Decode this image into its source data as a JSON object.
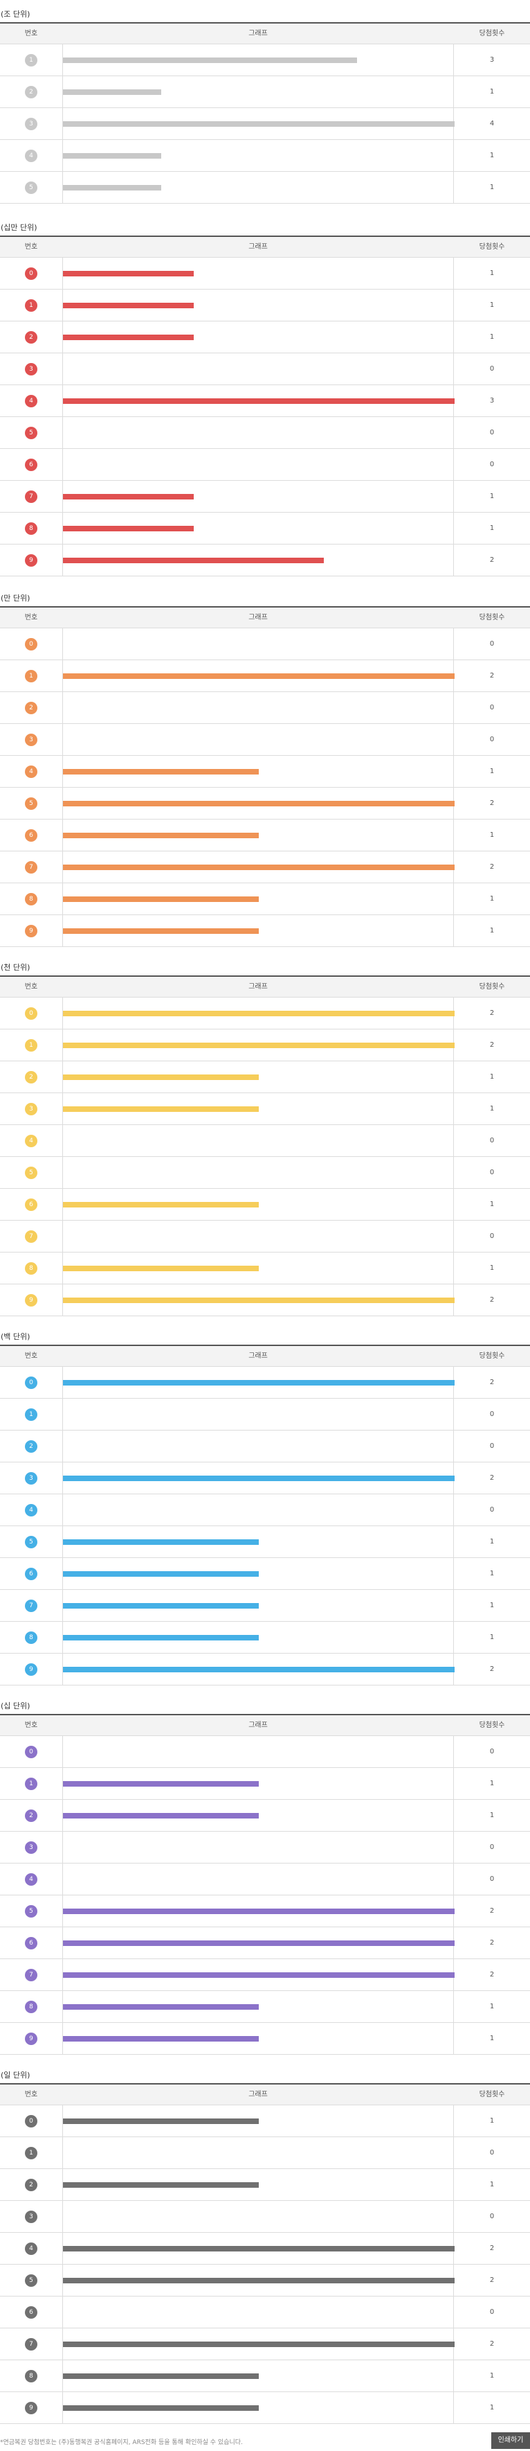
{
  "table_header": {
    "number": "번호",
    "graph": "그래프",
    "count": "당첨횟수"
  },
  "footer": {
    "note": "*연금복권 당첨번호는 (주)동행복권 공식홈페이지, ARS전화 등을 통해 확인하실 수 있습니다.",
    "print_label": "인쇄하기"
  },
  "chart_data": [
    {
      "type": "bar",
      "title": "(조 단위)",
      "color": "#c8c8c8",
      "categories": [
        "1",
        "2",
        "3",
        "4",
        "5"
      ],
      "values": [
        3,
        1,
        4,
        1,
        1
      ],
      "xlim": [
        0,
        4
      ]
    },
    {
      "type": "bar",
      "title": "(십만 단위)",
      "color": "#e05050",
      "categories": [
        "0",
        "1",
        "2",
        "3",
        "4",
        "5",
        "6",
        "7",
        "8",
        "9"
      ],
      "values": [
        1,
        1,
        1,
        0,
        3,
        0,
        0,
        1,
        1,
        2
      ],
      "xlim": [
        0,
        3
      ]
    },
    {
      "type": "bar",
      "title": "(만 단위)",
      "color": "#ef9355",
      "categories": [
        "0",
        "1",
        "2",
        "3",
        "4",
        "5",
        "6",
        "7",
        "8",
        "9"
      ],
      "values": [
        0,
        2,
        0,
        0,
        1,
        2,
        1,
        2,
        1,
        1
      ],
      "xlim": [
        0,
        2
      ]
    },
    {
      "type": "bar",
      "title": "(천 단위)",
      "color": "#f6cd5a",
      "categories": [
        "0",
        "1",
        "2",
        "3",
        "4",
        "5",
        "6",
        "7",
        "8",
        "9"
      ],
      "values": [
        2,
        2,
        1,
        1,
        0,
        0,
        1,
        0,
        1,
        2
      ],
      "xlim": [
        0,
        2
      ]
    },
    {
      "type": "bar",
      "title": "(백 단위)",
      "color": "#45b0e6",
      "categories": [
        "0",
        "1",
        "2",
        "3",
        "4",
        "5",
        "6",
        "7",
        "8",
        "9"
      ],
      "values": [
        2,
        0,
        0,
        2,
        0,
        1,
        1,
        1,
        1,
        2
      ],
      "xlim": [
        0,
        2
      ]
    },
    {
      "type": "bar",
      "title": "(십 단위)",
      "color": "#8b72c9",
      "categories": [
        "0",
        "1",
        "2",
        "3",
        "4",
        "5",
        "6",
        "7",
        "8",
        "9"
      ],
      "values": [
        0,
        1,
        1,
        0,
        0,
        2,
        2,
        2,
        1,
        1
      ],
      "xlim": [
        0,
        2
      ]
    },
    {
      "type": "bar",
      "title": "(일 단위)",
      "color": "#707070",
      "categories": [
        "0",
        "1",
        "2",
        "3",
        "4",
        "5",
        "6",
        "7",
        "8",
        "9"
      ],
      "values": [
        1,
        0,
        1,
        0,
        2,
        2,
        0,
        2,
        1,
        1
      ],
      "xlim": [
        0,
        2
      ]
    }
  ]
}
